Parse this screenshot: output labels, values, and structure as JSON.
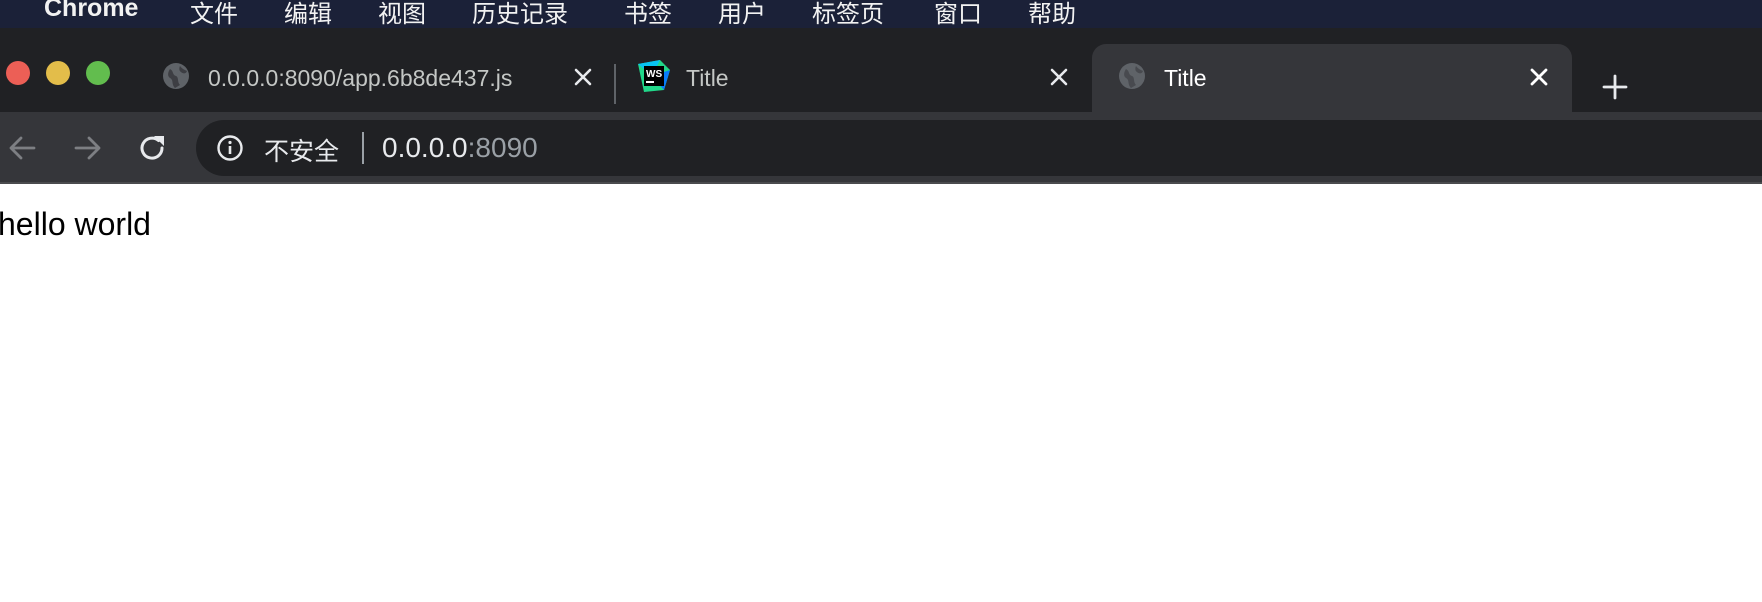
{
  "menubar": {
    "apple_glyph": "",
    "app_name": "Chrome",
    "items": [
      "文件",
      "编辑",
      "视图",
      "历史记录",
      "书签",
      "用户",
      "标签页",
      "窗口",
      "帮助"
    ]
  },
  "tabs": [
    {
      "title": "0.0.0.0:8090/app.6b8de437.js",
      "favicon": "globe-icon",
      "active": false
    },
    {
      "title": "Title",
      "favicon": "webstorm-icon",
      "active": false
    },
    {
      "title": "Title",
      "favicon": "globe-icon",
      "active": true
    }
  ],
  "omnibox": {
    "security_label": "不安全",
    "url_host": "0.0.0.0",
    "url_port": ":8090"
  },
  "page": {
    "text": "hello world"
  },
  "colors": {
    "menubar_bg": "#1b2138",
    "tabstrip_bg": "#202124",
    "active_tab_bg": "#35363a",
    "close_light": "#ec5f56",
    "minimize_light": "#e3bd4a",
    "zoom_light": "#62bd4e"
  }
}
